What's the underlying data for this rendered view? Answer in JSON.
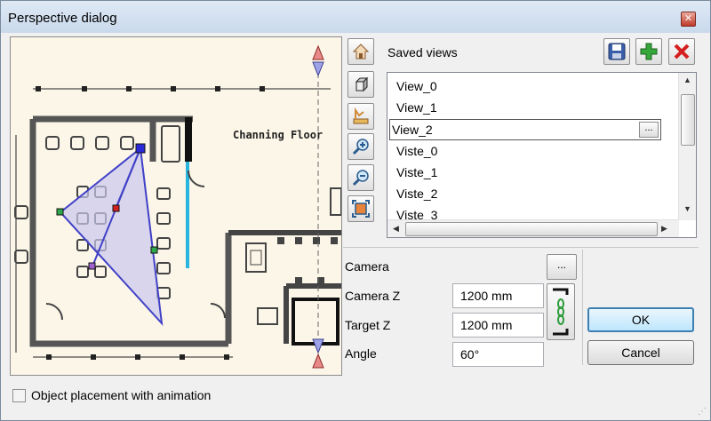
{
  "window": {
    "title": "Perspective dialog"
  },
  "preview": {
    "floor_label": "Channing Floor"
  },
  "saved_views": {
    "label": "Saved views",
    "items": [
      "View_0",
      "View_1",
      "View_2",
      "Viste_0",
      "Viste_1",
      "Viste_2",
      "Viste_3"
    ],
    "selected_index": 2,
    "ellipsis": "..."
  },
  "toolbar_icons": [
    "home-view-icon",
    "cube-view-icon",
    "measure-view-icon",
    "zoom-in-icon",
    "zoom-out-icon",
    "zoom-extents-icon"
  ],
  "actions": {
    "save": "save-icon",
    "add": "plus-icon",
    "delete": "delete-icon"
  },
  "camera": {
    "label": "Camera",
    "button": "...",
    "camera_z_label": "Camera Z",
    "camera_z_value": "1200 mm",
    "target_z_label": "Target Z",
    "target_z_value": "1200 mm",
    "angle_label": "Angle",
    "angle_value": "60°"
  },
  "buttons": {
    "ok": "OK",
    "cancel": "Cancel"
  },
  "animation": {
    "label": "Object placement with animation",
    "checked": false
  },
  "colors": {
    "accent": "#3c7fb1",
    "camera_cone": "#c9c7ee",
    "wall_accent": "#28b6de"
  }
}
